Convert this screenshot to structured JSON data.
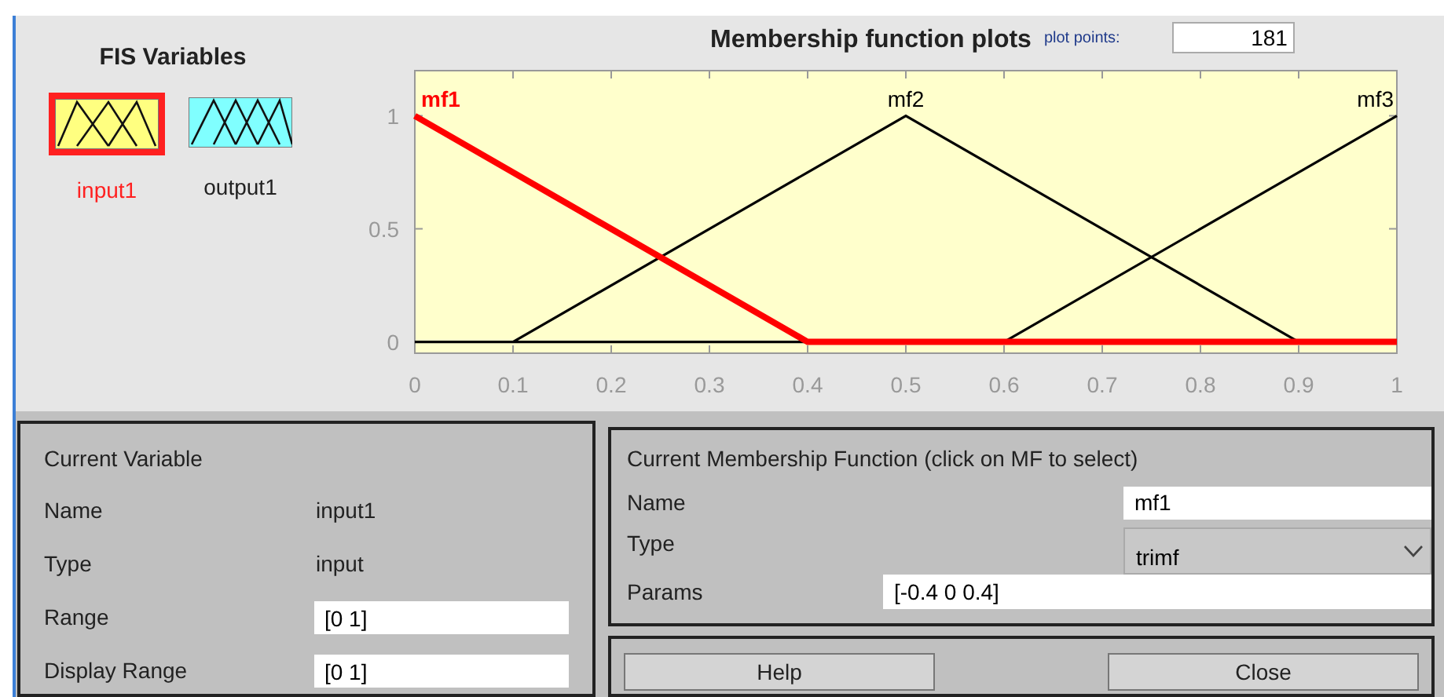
{
  "fis_variables": {
    "title": "FIS Variables",
    "items": [
      {
        "label": "input1",
        "kind": "input",
        "selected": true
      },
      {
        "label": "output1",
        "kind": "output",
        "selected": false
      }
    ]
  },
  "plot_panel": {
    "title": "Membership function plots",
    "plot_points_label": "plot points:",
    "plot_points": "181",
    "chart_data": {
      "type": "line",
      "x": [
        0,
        0.1,
        0.4,
        0.5,
        0.6,
        0.9,
        1
      ],
      "xlim": [
        0,
        1
      ],
      "ylim": [
        -0.05,
        1.2
      ],
      "xticks": [
        0,
        0.1,
        0.2,
        0.3,
        0.4,
        0.5,
        0.6,
        0.7,
        0.8,
        0.9,
        1
      ],
      "yticks": [
        0,
        0.5,
        1
      ],
      "series": [
        {
          "name": "mf1",
          "color": "#ff0000",
          "values": [
            1,
            0.75,
            0,
            0,
            0,
            0,
            0
          ]
        },
        {
          "name": "mf2",
          "color": "#000000",
          "values": [
            null,
            0,
            0.75,
            1,
            0.75,
            0,
            null
          ]
        },
        {
          "name": "mf3",
          "color": "#000000",
          "values": [
            null,
            null,
            null,
            null,
            0,
            0.75,
            1
          ]
        }
      ]
    }
  },
  "current_variable": {
    "title": "Current Variable",
    "rows": [
      {
        "kind": "text",
        "label": "Name",
        "value": "input1"
      },
      {
        "kind": "text",
        "label": "Type",
        "value": "input"
      },
      {
        "kind": "field",
        "label": "Range",
        "value": "[0 1]"
      },
      {
        "kind": "field",
        "label": "Display Range",
        "value": "[0 1]"
      }
    ]
  },
  "current_mf": {
    "title": "Current Membership Function (click on MF to select)",
    "name_label": "Name",
    "name": "mf1",
    "type_label": "Type",
    "type": "trimf",
    "params_label": "Params",
    "params": "[-0.4 0 0.4]"
  },
  "buttons": [
    "Help",
    "Close"
  ]
}
